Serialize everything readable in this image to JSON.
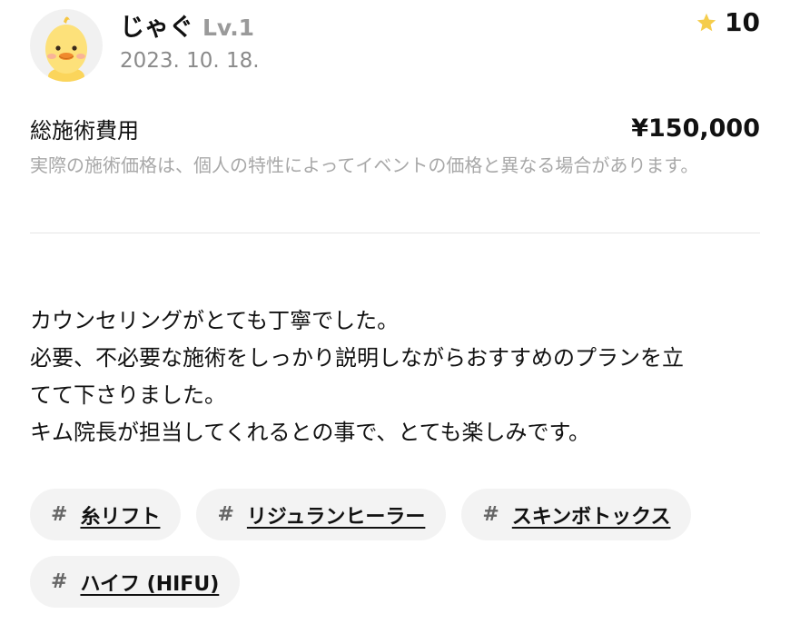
{
  "header": {
    "username": "じゃぐ",
    "level": "Lv.1",
    "date": "2023. 10. 18.",
    "rating": "10",
    "avatar_icon": "chick-avatar-icon",
    "star_icon": "star-icon",
    "star_color": "#f5cd4c"
  },
  "cost": {
    "label": "総施術費用",
    "value": "¥150,000",
    "note": "実際の施術価格は、個人の特性によってイベントの価格と異なる場合があります。"
  },
  "review": {
    "lines": [
      "カウンセリングがとても丁寧でした。",
      "必要、不必要な施術をしっかり説明しながらおすすめのプランを立",
      "てて下さりました。",
      "キム院長が担当してくれるとの事で、とても楽しみです。"
    ]
  },
  "tags": [
    {
      "hash": "#",
      "label": "糸リフト"
    },
    {
      "hash": "#",
      "label": "リジュランヒーラー"
    },
    {
      "hash": "#",
      "label": "スキンボトックス"
    },
    {
      "hash": "#",
      "label": "ハイフ (HIFU)"
    }
  ]
}
